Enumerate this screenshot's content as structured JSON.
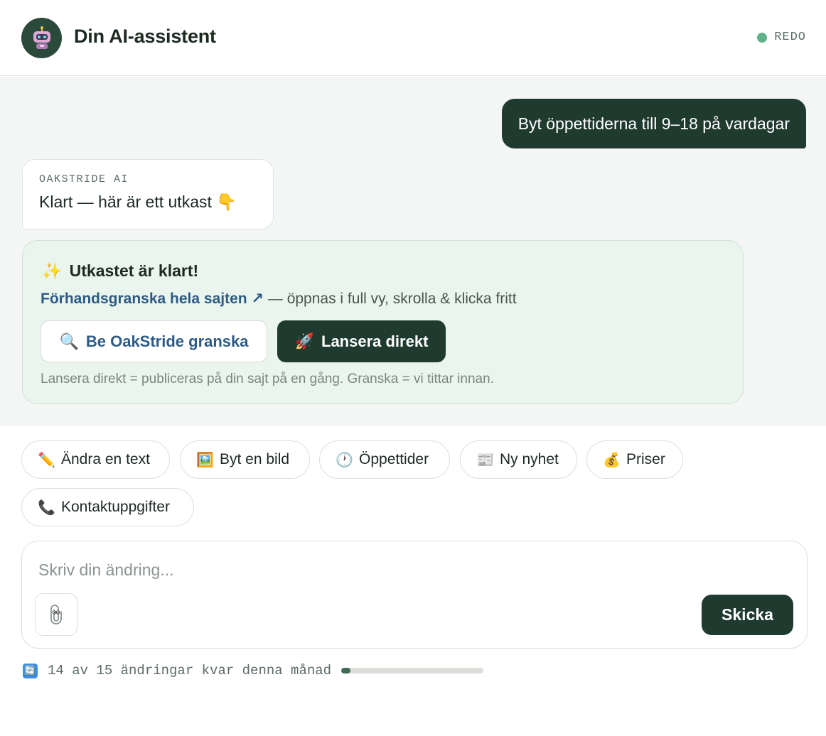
{
  "header": {
    "title": "Din AI-assistent",
    "avatar_icon": "robot-icon",
    "status_text": "REDO",
    "status_color": "#5fb387"
  },
  "chat": {
    "user_message": "Byt öppettiderna till 9–18 på vardagar",
    "ai_label": "OAKSTRIDE AI",
    "ai_message": "Klart — här är ett utkast 👇"
  },
  "draft": {
    "title": "Utkastet är klart!",
    "title_emoji": "✨",
    "preview_link": "Förhandsgranska hela sajten ↗",
    "preview_suffix": " — öppnas i full vy, skrolla & klicka fritt",
    "review_emoji": "🔍",
    "review_label": "Be OakStride granska",
    "launch_emoji": "🚀",
    "launch_label": "Lansera direkt",
    "note": "Lansera direkt = publiceras på din sajt på en gång. Granska = vi tittar innan."
  },
  "quick_actions": [
    {
      "emoji": "✏️",
      "label": "Ändra en text"
    },
    {
      "emoji": "🖼️",
      "label": "Byt en bild"
    },
    {
      "emoji": "🕐",
      "label": "Öppettider"
    },
    {
      "emoji": "📰",
      "label": "Ny nyhet"
    },
    {
      "emoji": "💰",
      "label": "Priser"
    },
    {
      "emoji": "📞",
      "label": "Kontaktuppgifter"
    }
  ],
  "composer": {
    "placeholder": "Skriv din ändring...",
    "attach_icon": "paperclip-icon",
    "send_label": "Skicka"
  },
  "usage": {
    "icon": "🔄",
    "text": "14 av 15 ändringar kvar denna månad",
    "used_fraction": 0.0667
  },
  "colors": {
    "primary_dark": "#1f3a2e",
    "link": "#2e5b85",
    "draft_bg": "#eaf5ee",
    "chat_bg": "#f3f6f4"
  }
}
